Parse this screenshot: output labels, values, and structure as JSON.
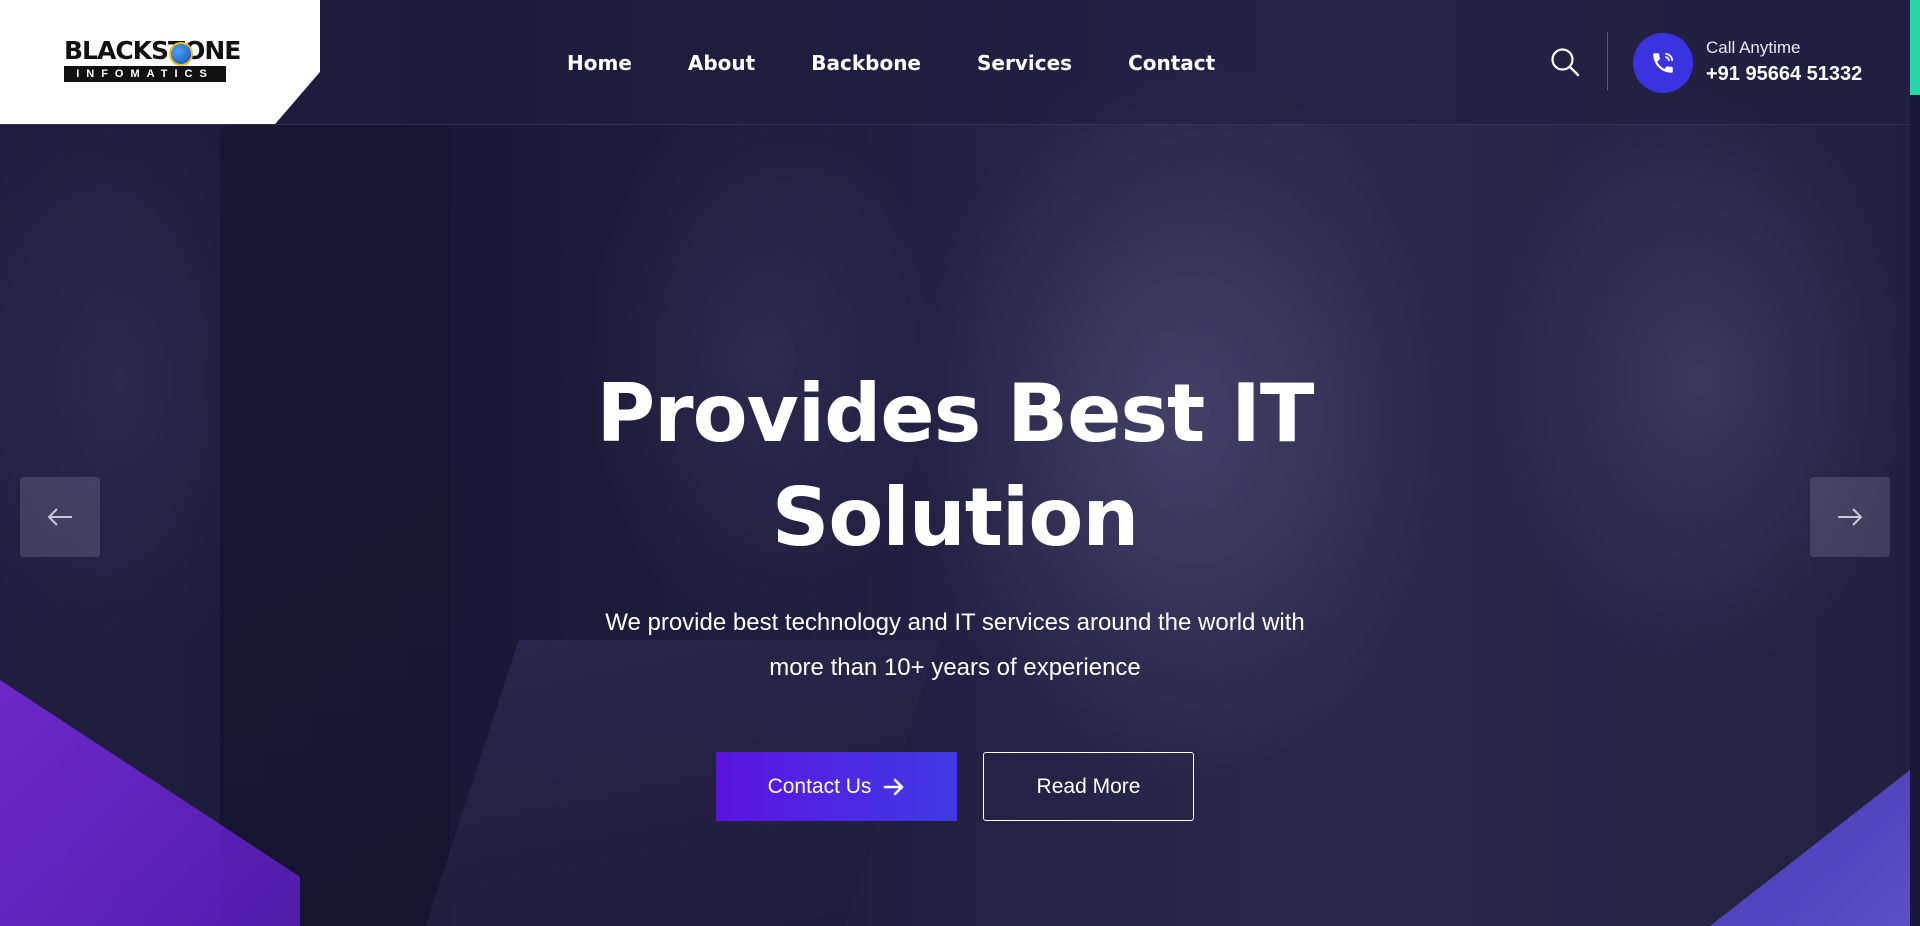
{
  "header": {
    "logo": {
      "top_text": "BLACKSTONE",
      "bottom_text": "INFOMATICS"
    },
    "nav": [
      {
        "label": "Home"
      },
      {
        "label": "About"
      },
      {
        "label": "Backbone"
      },
      {
        "label": "Services"
      },
      {
        "label": "Contact"
      }
    ],
    "search_icon": "search-icon",
    "call": {
      "icon": "phone-icon",
      "label": "Call Anytime",
      "number": "+91 95664 51332"
    }
  },
  "hero": {
    "title_line1": "Provides Best IT",
    "title_line2": "Solution",
    "subtitle_line1": "We provide best technology and IT services around the world with",
    "subtitle_line2": "more than 10+ years of experience",
    "primary_button": {
      "label": "Contact Us",
      "icon": "arrow-right-icon"
    },
    "secondary_button": {
      "label": "Read More"
    },
    "prev_arrow_icon": "arrow-left-icon",
    "next_arrow_icon": "arrow-right-icon"
  },
  "colors": {
    "accent": "#3a33e0",
    "button_gradient_start": "#5b14e0",
    "button_gradient_end": "#3f3ae6",
    "edge_accent": "#25d9a6",
    "overlay": "#1b1936"
  }
}
